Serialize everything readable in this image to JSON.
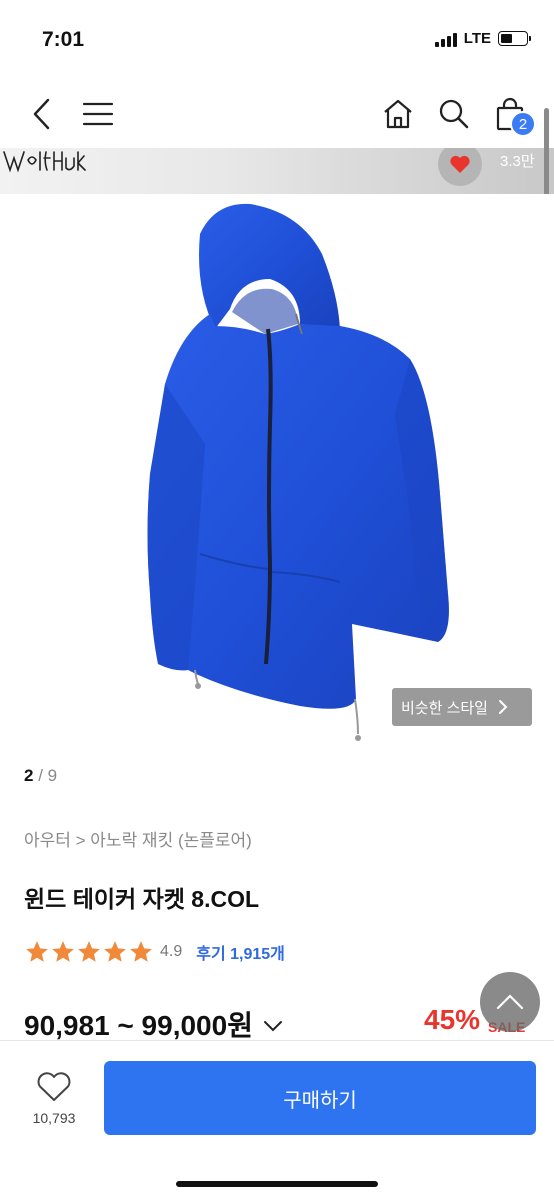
{
  "status_bar": {
    "time": "7:01",
    "network": "LTE"
  },
  "nav": {
    "cart_count": "2"
  },
  "brand": {
    "logo_text": "Wolfhuk",
    "like_count": "3.3만"
  },
  "image": {
    "similar_style_label": "비슷한 스타일",
    "current_page": "2",
    "separator": " / ",
    "total_pages": "9"
  },
  "breadcrumb": "아우터 > 아노락 재킷 (논플로어)",
  "product": {
    "title": "윈드 테이커 자켓 8.COL",
    "rating": "4.9",
    "review_label": "후기 1,915개",
    "price": "90,981 ~ 99,000원",
    "discount": "45%",
    "sale_label": "SALE"
  },
  "bottom_bar": {
    "wish_count": "10,793",
    "buy_label": "구매하기"
  },
  "colors": {
    "accent": "#2e74f0",
    "sale": "#e8362f",
    "star": "#f08a3a",
    "jacket": "#1f4fd6"
  },
  "icons": [
    "back-icon",
    "menu-icon",
    "home-icon",
    "search-icon",
    "shopping-bag-icon",
    "heart-icon",
    "chevron-right-icon",
    "star-icon",
    "chevron-down-icon",
    "chevron-up-icon",
    "heart-outline-icon"
  ]
}
